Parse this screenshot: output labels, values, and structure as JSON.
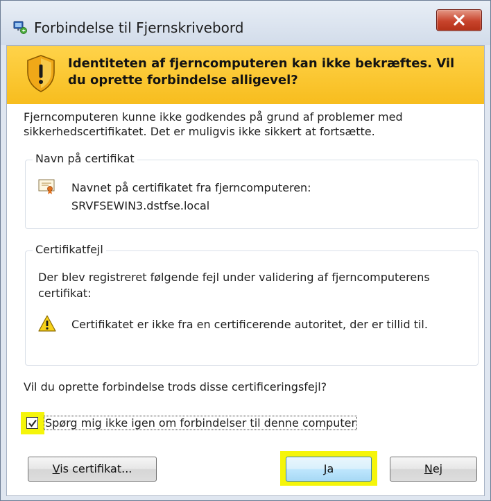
{
  "window": {
    "title": "Forbindelse til Fjernskrivebord",
    "icons": {
      "app": "remote-desktop-icon",
      "close": "close-icon"
    },
    "colors": {
      "banner": "#f7bd1e",
      "highlight": "#f5f50a",
      "close": "#c8442c"
    }
  },
  "banner": {
    "icon": "warning-shield-icon",
    "text": "Identiteten af fjerncomputeren kan ikke bekræftes. Vil du oprette forbindelse alligevel?"
  },
  "description": "Fjerncomputeren kunne ikke godkendes på grund af problemer med sikkerhedscertifikatet. Det er muligvis ikke sikkert at fortsætte.",
  "cert_name_group": {
    "title": "Navn på certifikat",
    "icon": "certificate-icon",
    "label": "Navnet på certifikatet fra fjerncomputeren:",
    "value": "SRVFSEWIN3.dstfse.local"
  },
  "cert_error_group": {
    "title": "Certifikatfejl",
    "description": "Der blev registreret følgende fejl under validering af fjerncomputerens certifikat:",
    "icon": "warning-icon",
    "error": "Certifikatet er ikke fra en certificerende autoritet, der er tillid til."
  },
  "question": "Vil du oprette forbindelse trods disse certificeringsfejl?",
  "checkbox": {
    "checked": true,
    "label": "Spørg mig ikke igen om forbindelser til denne computer"
  },
  "buttons": {
    "view_cert_mnemonic": "V",
    "view_cert_rest": "is certifikat...",
    "yes_mnemonic": "J",
    "yes_rest": "a",
    "no_mnemonic": "N",
    "no_rest": "ej"
  }
}
